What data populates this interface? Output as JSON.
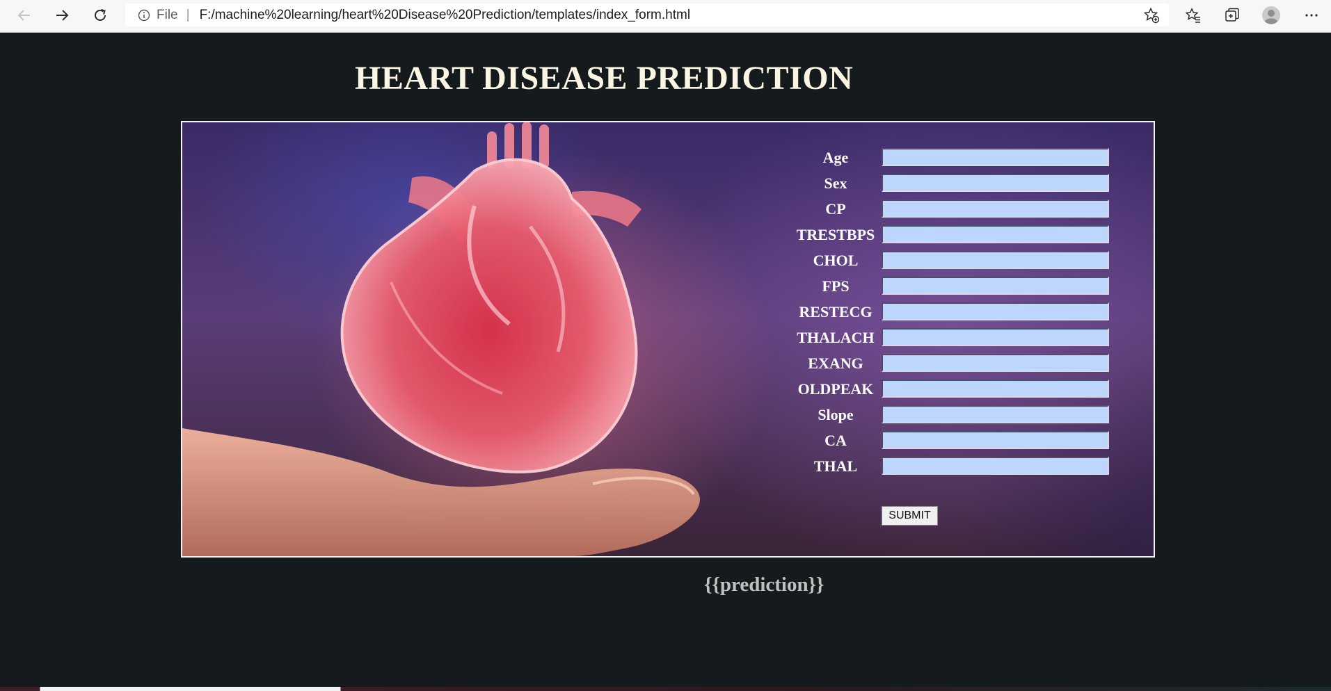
{
  "browser": {
    "address_scheme": "File",
    "url": "F:/machine%20learning/heart%20Disease%20Prediction/templates/index_form.html"
  },
  "icons": {
    "back": "back-arrow-icon",
    "forward": "forward-arrow-icon",
    "refresh": "refresh-icon",
    "info": "info-icon",
    "add_favorite": "add-favorite-icon",
    "favorites": "favorites-icon",
    "collections": "collections-icon",
    "profile": "profile-avatar-icon",
    "more": "more-options-icon"
  },
  "page": {
    "title": "HEART DISEASE PREDICTION",
    "form": {
      "fields": [
        {
          "label": "Age",
          "value": ""
        },
        {
          "label": "Sex",
          "value": ""
        },
        {
          "label": "CP",
          "value": ""
        },
        {
          "label": "TRESTBPS",
          "value": ""
        },
        {
          "label": "CHOL",
          "value": ""
        },
        {
          "label": "FPS",
          "value": ""
        },
        {
          "label": "RESTECG",
          "value": ""
        },
        {
          "label": "THALACH",
          "value": ""
        },
        {
          "label": "EXANG",
          "value": ""
        },
        {
          "label": "OLDPEAK",
          "value": ""
        },
        {
          "label": "Slope",
          "value": ""
        },
        {
          "label": "CA",
          "value": ""
        },
        {
          "label": "THAL",
          "value": ""
        }
      ],
      "submit_label": "SUBMIT"
    },
    "prediction_text": "{{prediction}}"
  },
  "colors": {
    "page_background": "#151a1c",
    "title": "#fbf6e4",
    "input_background": "#bcd6fd",
    "prediction": "#c1c0c0"
  }
}
